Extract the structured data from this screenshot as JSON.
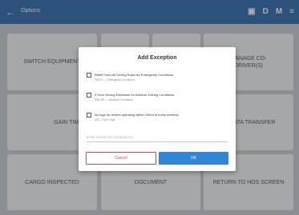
{
  "appbar": {
    "title": "Options",
    "icons": [
      "back-arrow-icon",
      "screen-icon",
      "D",
      "M",
      "menu-icon"
    ],
    "status_letters": [
      "D",
      "M"
    ]
  },
  "tiles": [
    {
      "label": "SWITCH EQUIPMENT"
    },
    {
      "label": ""
    },
    {
      "label": ""
    },
    {
      "label": "MANAGE CO-DRIVER(S)"
    },
    {
      "label": "GAIN TIME"
    },
    {
      "label": "DATA TRANSFER"
    },
    {
      "label": "CARGO INSPECTED"
    },
    {
      "label": "DOCUMENT"
    },
    {
      "label": "RETURN TO HOS SCREEN"
    }
  ],
  "dialog": {
    "title": "Add Exception",
    "options": [
      {
        "label": "Relief From All Driving Rules for Emergency Conditions",
        "sub": "FMCS — Emergency Conditions"
      },
      {
        "label": "2 Hour Driving Extension for Adverse Driving Conditions",
        "sub": "FMCSR — Adverse Conditions"
      },
      {
        "label": "No logs for drivers operating within 100mi of home terminal",
        "sub": "US — Non Logs"
      }
    ],
    "reason_placeholder": "Enter reason for exception(s)",
    "cancel_label": "Cancel",
    "ok_label": "OK"
  },
  "colors": {
    "appbar": "#2f6db1",
    "ok_button": "#2f86d6",
    "cancel_text": "#c94a4a"
  }
}
